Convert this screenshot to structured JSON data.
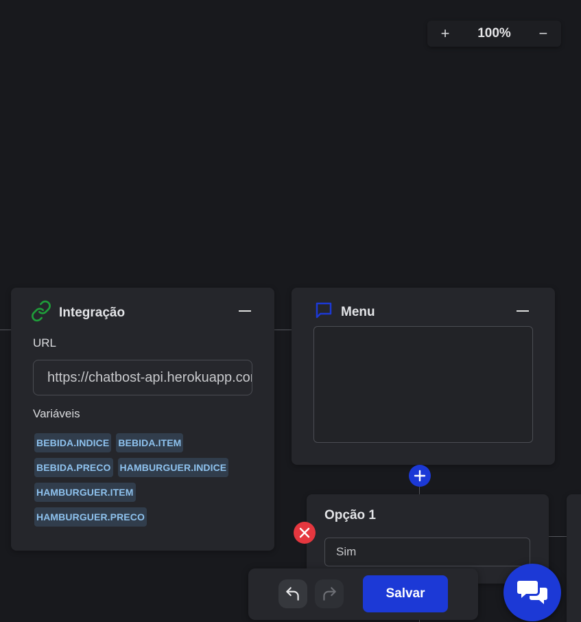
{
  "zoom": {
    "in_label": "+",
    "value": "100%",
    "out_label": "−"
  },
  "integration_card": {
    "title": "Integração",
    "icon": "link-icon",
    "url_label": "URL",
    "url_value": "https://chatbost-api.herokuapp.com",
    "variables_label": "Variáveis",
    "variables": [
      [
        "BEBIDA.INDICE",
        "BEBIDA.ITEM"
      ],
      [
        "BEBIDA.PRECO",
        "HAMBURGUER.INDICE"
      ],
      [
        "HAMBURGUER.ITEM"
      ],
      [
        "HAMBURGUER.PRECO"
      ]
    ]
  },
  "menu_card": {
    "title": "Menu",
    "icon": "chat-bubble-icon",
    "message": ""
  },
  "option_card": {
    "title": "Opção 1",
    "value": "Sim"
  },
  "toolbar": {
    "save_label": "Salvar"
  },
  "colors": {
    "background": "#18191d",
    "card": "#25262b",
    "accent_blue": "#1c39d6",
    "danger_red": "#e5373f",
    "link_green": "#1f9e3a",
    "tag_text": "#8ec2ee"
  }
}
